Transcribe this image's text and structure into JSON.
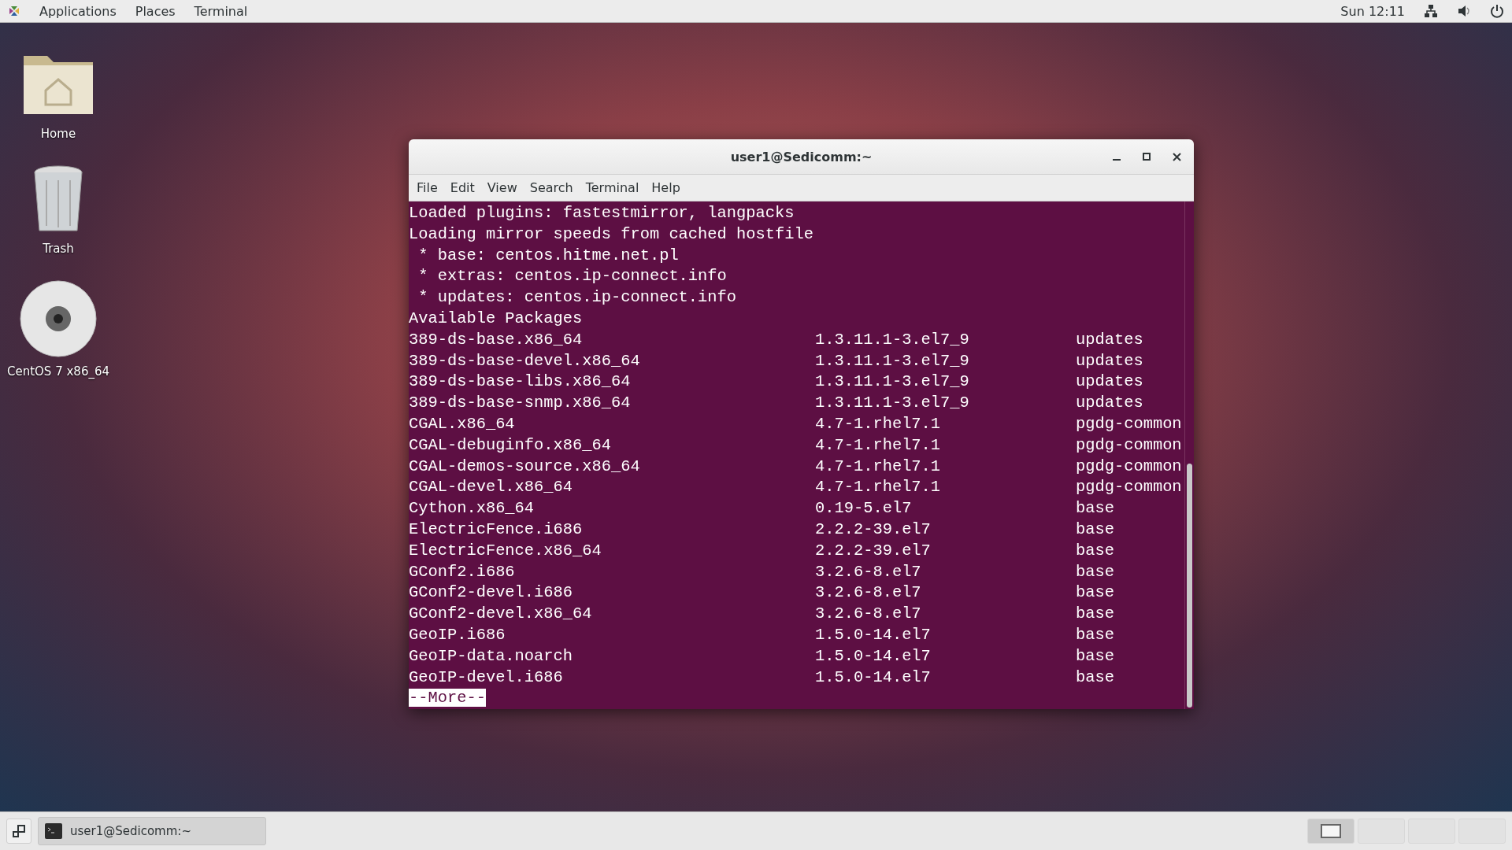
{
  "top_bar": {
    "menus": [
      "Applications",
      "Places",
      "Terminal"
    ],
    "clock": "Sun 12:11"
  },
  "desktop_icons": [
    {
      "kind": "folder",
      "label": "Home"
    },
    {
      "kind": "trash",
      "label": "Trash"
    },
    {
      "kind": "disc",
      "label": "CentOS 7 x86_64"
    }
  ],
  "terminal": {
    "title": "user1@Sedicomm:~",
    "menu": [
      "File",
      "Edit",
      "View",
      "Search",
      "Terminal",
      "Help"
    ],
    "lines": [
      "Loaded plugins: fastestmirror, langpacks",
      "Loading mirror speeds from cached hostfile",
      " * base: centos.hitme.net.pl",
      " * extras: centos.ip-connect.info",
      " * updates: centos.ip-connect.info",
      "Available Packages"
    ],
    "packages": [
      [
        "389-ds-base.x86_64",
        "1.3.11.1-3.el7_9",
        "updates"
      ],
      [
        "389-ds-base-devel.x86_64",
        "1.3.11.1-3.el7_9",
        "updates"
      ],
      [
        "389-ds-base-libs.x86_64",
        "1.3.11.1-3.el7_9",
        "updates"
      ],
      [
        "389-ds-base-snmp.x86_64",
        "1.3.11.1-3.el7_9",
        "updates"
      ],
      [
        "CGAL.x86_64",
        "4.7-1.rhel7.1",
        "pgdg-common"
      ],
      [
        "CGAL-debuginfo.x86_64",
        "4.7-1.rhel7.1",
        "pgdg-common"
      ],
      [
        "CGAL-demos-source.x86_64",
        "4.7-1.rhel7.1",
        "pgdg-common"
      ],
      [
        "CGAL-devel.x86_64",
        "4.7-1.rhel7.1",
        "pgdg-common"
      ],
      [
        "Cython.x86_64",
        "0.19-5.el7",
        "base"
      ],
      [
        "ElectricFence.i686",
        "2.2.2-39.el7",
        "base"
      ],
      [
        "ElectricFence.x86_64",
        "2.2.2-39.el7",
        "base"
      ],
      [
        "GConf2.i686",
        "3.2.6-8.el7",
        "base"
      ],
      [
        "GConf2-devel.i686",
        "3.2.6-8.el7",
        "base"
      ],
      [
        "GConf2-devel.x86_64",
        "3.2.6-8.el7",
        "base"
      ],
      [
        "GeoIP.i686",
        "1.5.0-14.el7",
        "base"
      ],
      [
        "GeoIP-data.noarch",
        "1.5.0-14.el7",
        "base"
      ],
      [
        "GeoIP-devel.i686",
        "1.5.0-14.el7",
        "base"
      ]
    ],
    "pager_prompt": "--More--"
  },
  "taskbar": {
    "window_button": "user1@Sedicomm:~",
    "workspaces": [
      {
        "selected": true
      },
      {
        "selected": false
      },
      {
        "selected": false
      },
      {
        "selected": false
      }
    ]
  }
}
